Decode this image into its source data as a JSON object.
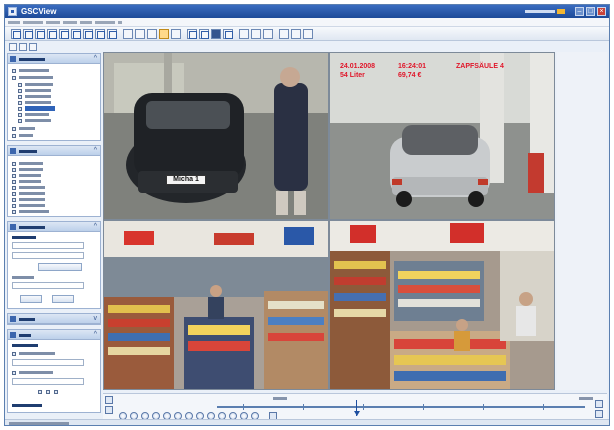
{
  "window": {
    "title": "GSCView"
  },
  "cameras": [
    {
      "name": "",
      "plate_text": "Micha 1",
      "overlay": []
    },
    {
      "name": "",
      "overlay": [
        "24.01.2008",
        "16:24:01",
        "ZAPFSÄULE 4",
        "54 Liter",
        "69,74 €"
      ]
    },
    {
      "name": "",
      "overlay": []
    },
    {
      "name": "",
      "overlay": []
    }
  ],
  "colors": {
    "titlebar": "#1d4a98",
    "accent": "#2f63b8",
    "overlay_text": "#e0162a",
    "panel_border": "#9db2d2"
  },
  "icons": {
    "app": "app-logo-icon",
    "minimize": "minimize-icon",
    "maximize": "maximize-icon",
    "close": "close-icon"
  }
}
